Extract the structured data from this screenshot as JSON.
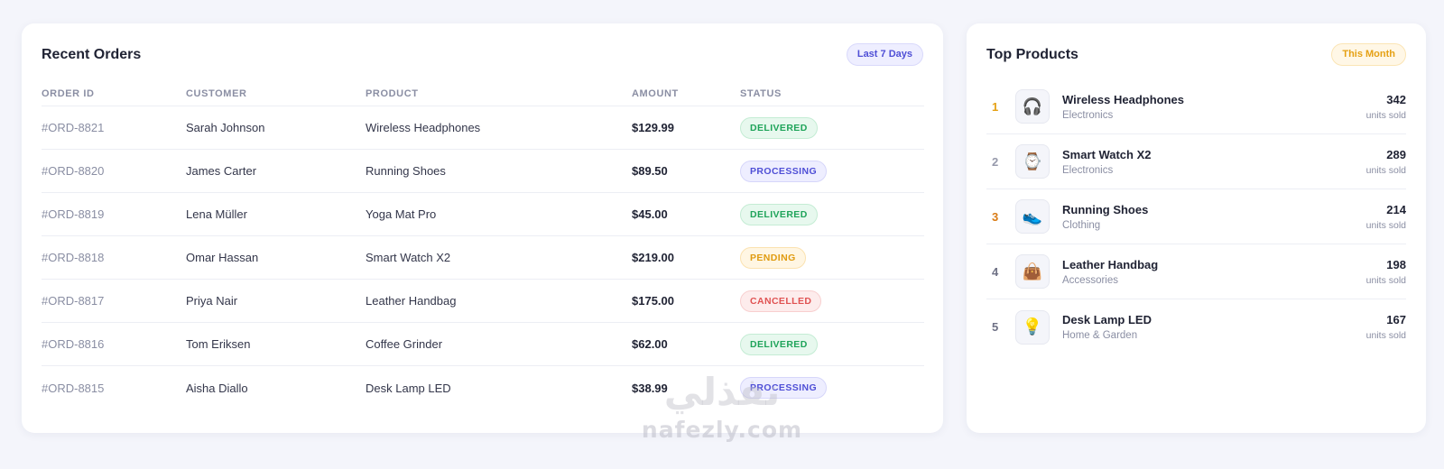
{
  "orders": {
    "title": "Recent Orders",
    "range_label": "Last 7 Days",
    "columns": [
      "ORDER ID",
      "CUSTOMER",
      "PRODUCT",
      "AMOUNT",
      "STATUS"
    ],
    "rows": [
      {
        "id": "#ORD-8821",
        "customer": "Sarah Johnson",
        "product": "Wireless Headphones",
        "amount": "$129.99",
        "status": "DELIVERED"
      },
      {
        "id": "#ORD-8820",
        "customer": "James Carter",
        "product": "Running Shoes",
        "amount": "$89.50",
        "status": "PROCESSING"
      },
      {
        "id": "#ORD-8819",
        "customer": "Lena Müller",
        "product": "Yoga Mat Pro",
        "amount": "$45.00",
        "status": "DELIVERED"
      },
      {
        "id": "#ORD-8818",
        "customer": "Omar Hassan",
        "product": "Smart Watch X2",
        "amount": "$219.00",
        "status": "PENDING"
      },
      {
        "id": "#ORD-8817",
        "customer": "Priya Nair",
        "product": "Leather Handbag",
        "amount": "$175.00",
        "status": "CANCELLED"
      },
      {
        "id": "#ORD-8816",
        "customer": "Tom Eriksen",
        "product": "Coffee Grinder",
        "amount": "$62.00",
        "status": "DELIVERED"
      },
      {
        "id": "#ORD-8815",
        "customer": "Aisha Diallo",
        "product": "Desk Lamp LED",
        "amount": "$38.99",
        "status": "PROCESSING"
      }
    ]
  },
  "top_products": {
    "title": "Top Products",
    "range_label": "This Month",
    "unit_label": "units sold",
    "items": [
      {
        "rank": "1",
        "name": "Wireless Headphones",
        "category": "Electronics",
        "count": "342",
        "icon": "headphones-icon",
        "glyph": "🎧"
      },
      {
        "rank": "2",
        "name": "Smart Watch X2",
        "category": "Electronics",
        "count": "289",
        "icon": "watch-icon",
        "glyph": "⌚"
      },
      {
        "rank": "3",
        "name": "Running Shoes",
        "category": "Clothing",
        "count": "214",
        "icon": "shoe-icon",
        "glyph": "👟"
      },
      {
        "rank": "4",
        "name": "Leather Handbag",
        "category": "Accessories",
        "count": "198",
        "icon": "handbag-icon",
        "glyph": "👜"
      },
      {
        "rank": "5",
        "name": "Desk Lamp LED",
        "category": "Home & Garden",
        "count": "167",
        "icon": "lightbulb-icon",
        "glyph": "💡"
      }
    ]
  },
  "watermark": {
    "arabic": "نفذلي",
    "latin": "nafezly.com"
  },
  "colors": {
    "accent": "#4f4fd6",
    "delivered": "#1fa45a",
    "pending": "#e09b10",
    "cancelled": "#e05252",
    "gold": "#e5a115"
  }
}
